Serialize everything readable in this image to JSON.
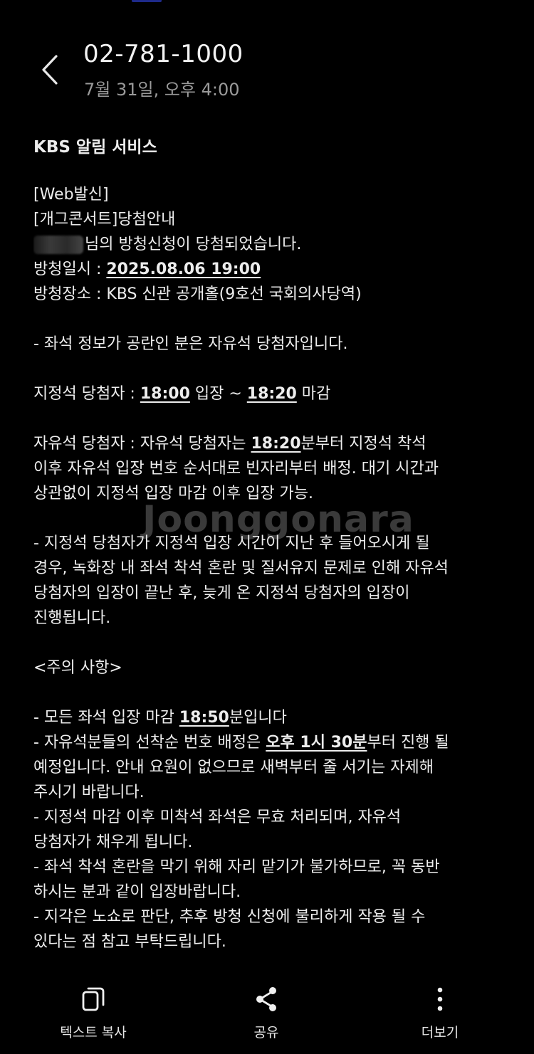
{
  "header": {
    "sender": "02-781-1000",
    "timestamp": "7월 31일, 오후 4:00"
  },
  "message": {
    "title": "KBS 알림 서비스",
    "l1": "[Web발신]",
    "l2": "[개그콘서트]당첨안내",
    "l3": "님의 방청신청이 당첨되었습니다.",
    "l4_label": "방청일시 : ",
    "l4_value": "2025.08.06 19:00",
    "l5": "방청장소 : KBS 신관 공개홀(9호선 국회의사당역)",
    "l6": "- 좌석 정보가 공란인 분은 자유석 당첨자입니다.",
    "l7_a": "지정석 당첨자 : ",
    "l7_b": "18:00",
    "l7_c": " 입장 ~ ",
    "l7_d": "18:20",
    "l7_e": " 마감",
    "l8_a": "자유석 당첨자 : 자유석 당첨자는 ",
    "l8_b": "18:20",
    "l8_c": "분부터 지정석 착석",
    "l9": "이후 자유석 입장 번호 순서대로 빈자리부터 배정. 대기 시간과",
    "l10": "상관없이 지정석 입장 마감 이후 입장 가능.",
    "l11": "- 지정석 당첨자가 지정석 입장 시간이 지난 후 들어오시게 될",
    "l12": "경우, 녹화장 내 좌석 착석 혼란 및 질서유지 문제로 인해 자유석",
    "l13": "당첨자의 입장이 끝난 후, 늦게 온 지정석 당첨자의 입장이",
    "l14": "진행됩니다.",
    "l15": "<주의 사항>",
    "l16_a": "- 모든 좌석 입장 마감 ",
    "l16_b": "18:50",
    "l16_c": "분입니다",
    "l17_a": "- 자유석분들의 선착순 번호 배정은 ",
    "l17_b": "오후 1시 30분",
    "l17_c": "부터 진행 될",
    "l18": "예정입니다. 안내 요원이 없으므로 새벽부터 줄 서기는 자제해",
    "l19": "주시기 바랍니다.",
    "l20": "- 지정석 마감 이후 미착석 좌석은 무효 처리되며, 자유석",
    "l21": "당첨자가 채우게 됩니다.",
    "l22": "- 좌석 착석 혼란을 막기 위해 자리 맡기가 불가하므로, 꼭 동반",
    "l23": "하시는 분과 같이 입장바랍니다.",
    "l24": "- 지각은 노쇼로 판단, 추후 방청 신청에 불리하게 작용 될 수",
    "l25": "있다는 점 참고 부탁드립니다."
  },
  "watermark": "Joonggonara",
  "actions": {
    "copy": "텍스트 복사",
    "share": "공유",
    "more": "더보기"
  },
  "icons": {
    "back": "chevron-left-icon",
    "copy": "copy-icon",
    "share": "share-icon",
    "more": "more-vertical-icon"
  }
}
